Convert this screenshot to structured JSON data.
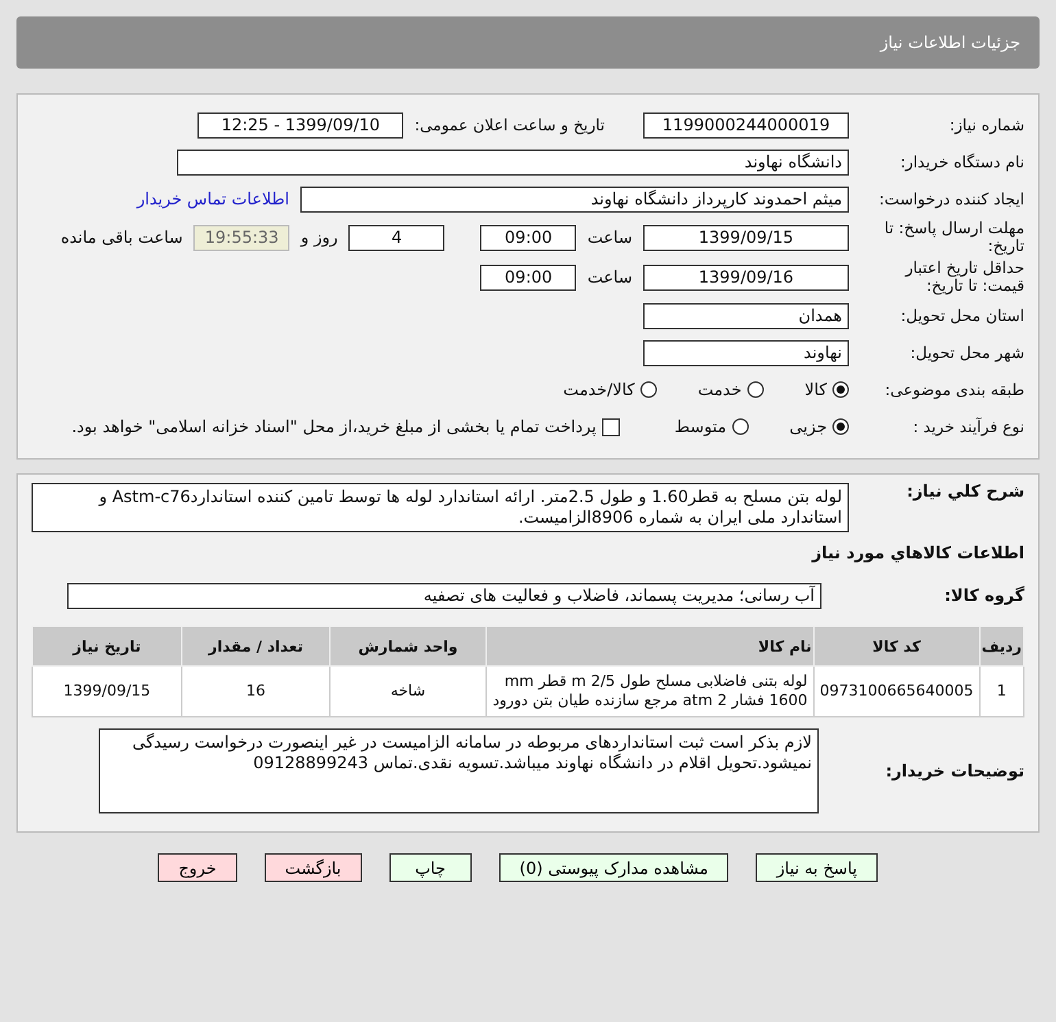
{
  "header": {
    "title": "جزئیات اطلاعات نیاز"
  },
  "need_number": {
    "label": "شماره نیاز:",
    "value": "1199000244000019"
  },
  "announce": {
    "label": "تاریخ و ساعت اعلان عمومی:",
    "value": "1399/09/10 - 12:25"
  },
  "buyer_org": {
    "label": "نام دستگاه خریدار:",
    "value": "دانشگاه نهاوند"
  },
  "creator": {
    "label": "ایجاد کننده درخواست:",
    "value": "میثم احمدوند کارپرداز دانشگاه نهاوند",
    "link": "اطلاعات تماس خریدار"
  },
  "deadline": {
    "label": "مهلت ارسال پاسخ: تا تاریخ:",
    "date": "1399/09/15",
    "time_label": "ساعت",
    "time": "09:00",
    "days": "4",
    "days_label": "روز و",
    "remaining": "19:55:33",
    "remaining_label": "ساعت باقی مانده"
  },
  "validity": {
    "label": "حداقل تاریخ اعتبار قیمت: تا تاریخ:",
    "date": "1399/09/16",
    "time_label": "ساعت",
    "time": "09:00"
  },
  "province": {
    "label": "استان محل تحویل:",
    "value": "همدان"
  },
  "city": {
    "label": "شهر محل تحویل:",
    "value": "نهاوند"
  },
  "category": {
    "label": "طبقه بندی موضوعی:",
    "options": [
      {
        "label": "کالا",
        "selected": true
      },
      {
        "label": "خدمت",
        "selected": false
      },
      {
        "label": "کالا/خدمت",
        "selected": false
      }
    ]
  },
  "purchase_type": {
    "label": "نوع فرآیند خرید :",
    "options": [
      {
        "label": "جزیی",
        "selected": true
      },
      {
        "label": "متوسط",
        "selected": false
      }
    ],
    "treasury": {
      "label": "پرداخت تمام یا بخشی از مبلغ خرید،از محل \"اسناد خزانه اسلامی\" خواهد بود.",
      "checked": false
    }
  },
  "description": {
    "label": "شرح کلي نياز:",
    "value": "لوله بتن مسلح به قطر1.60 و طول 2.5متر. ارائه استاندارد لوله ها توسط تامین کننده استانداردAstm-c76 و استاندارد ملی ایران به شماره 8906الزامیست."
  },
  "goods_title": "اطلاعات کالاهاي مورد نياز",
  "goods_group": {
    "label": "گروه کالا:",
    "value": "آب رسانی؛ مدیریت پسماند، فاضلاب و فعالیت های تصفیه"
  },
  "table": {
    "columns": [
      "ردیف",
      "کد کالا",
      "نام کالا",
      "واحد شمارش",
      "تعداد / مقدار",
      "تاریخ نیاز"
    ],
    "rows": [
      [
        "1",
        "0973100665640005",
        "لوله بتنی فاضلابی مسلح طول m 2/5 قطر mm 1600 فشار 2 atm مرجع سازنده طیان بتن دورود",
        "شاخه",
        "16",
        "1399/09/15"
      ]
    ]
  },
  "buyer_notes": {
    "label": "توضیحات خریدار:",
    "value": "لازم بذکر است ثبت استانداردهای مربوطه در سامانه الزامیست در غیر اینصورت درخواست رسیدگی نمیشود.تحویل اقلام در دانشگاه نهاوند میباشد.تسویه نقدی.تماس 09128899243"
  },
  "buttons": [
    {
      "label": "پاسخ به نیاز",
      "kind": "normal"
    },
    {
      "label": "مشاهده مدارک پیوستی (0)",
      "kind": "normal"
    },
    {
      "label": "چاپ",
      "kind": "normal"
    },
    {
      "label": "بازگشت",
      "kind": "warning"
    },
    {
      "label": "خروج",
      "kind": "warning"
    }
  ]
}
